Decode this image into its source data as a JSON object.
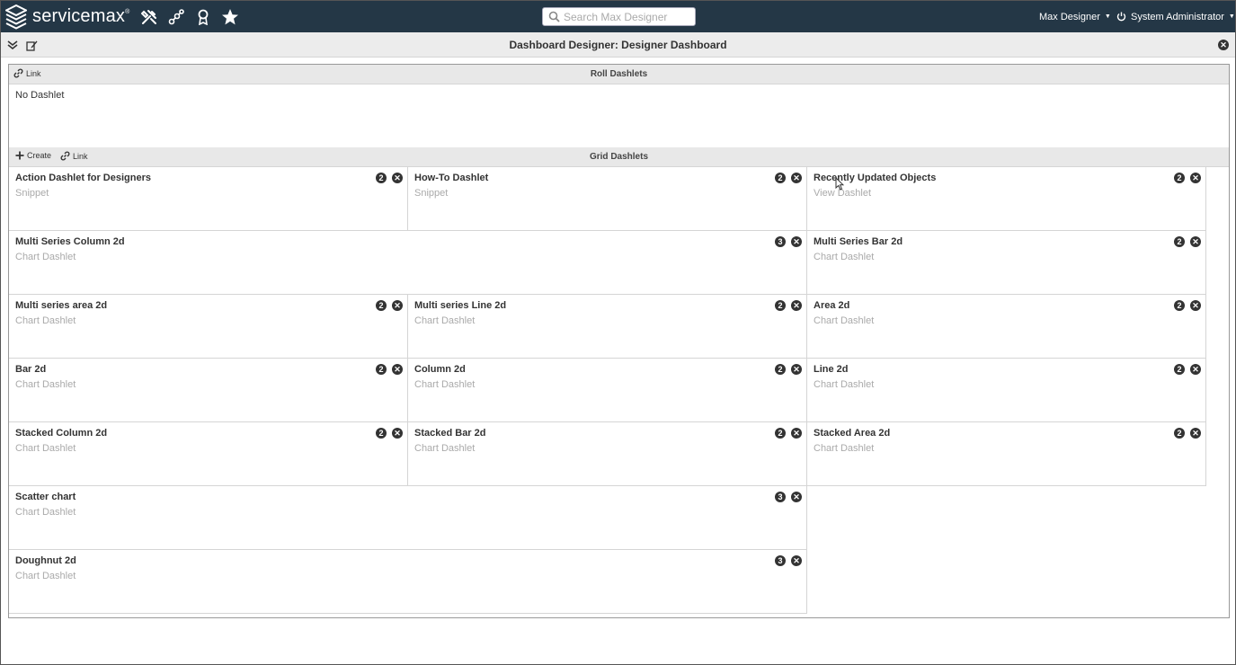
{
  "brand": {
    "name": "servicemax"
  },
  "nav_icons": [
    "tools-icon",
    "connections-icon",
    "badge-icon",
    "star-icon"
  ],
  "search": {
    "placeholder": "Search Max Designer"
  },
  "header_menus": {
    "app_label": "Max Designer",
    "user_label": "System Administrator"
  },
  "page": {
    "title": "Dashboard Designer: Designer Dashboard"
  },
  "roll_section": {
    "title": "Roll Dashlets",
    "link_label": "Link",
    "empty_text": "No Dashlet"
  },
  "grid_section": {
    "title": "Grid Dashlets",
    "create_label": "Create",
    "link_label": "Link"
  },
  "dashlets": [
    {
      "title": "Action Dashlet for Designers",
      "type": "Snippet",
      "size": "2"
    },
    {
      "title": "How-To Dashlet",
      "type": "Snippet",
      "size": "2"
    },
    {
      "title": "Recently Updated Objects",
      "type": "View Dashlet",
      "size": "2"
    },
    {
      "title": "Multi Series Column 2d",
      "type": "Chart Dashlet",
      "size": "3"
    },
    {
      "title": "Multi Series Bar 2d",
      "type": "Chart Dashlet",
      "size": "2"
    },
    {
      "title": "Multi series area 2d",
      "type": "Chart Dashlet",
      "size": "2"
    },
    {
      "title": "Multi series Line 2d",
      "type": "Chart Dashlet",
      "size": "2"
    },
    {
      "title": "Area 2d",
      "type": "Chart Dashlet",
      "size": "2"
    },
    {
      "title": "Bar 2d",
      "type": "Chart Dashlet",
      "size": "2"
    },
    {
      "title": "Column 2d",
      "type": "Chart Dashlet",
      "size": "2"
    },
    {
      "title": "Line 2d",
      "type": "Chart Dashlet",
      "size": "2"
    },
    {
      "title": "Stacked Column 2d",
      "type": "Chart Dashlet",
      "size": "2"
    },
    {
      "title": "Stacked Bar 2d",
      "type": "Chart Dashlet",
      "size": "2"
    },
    {
      "title": "Stacked Area 2d",
      "type": "Chart Dashlet",
      "size": "2"
    },
    {
      "title": "Scatter chart",
      "type": "Chart Dashlet",
      "size": "3"
    },
    {
      "title": "Doughnut 2d",
      "type": "Chart Dashlet",
      "size": "3"
    }
  ],
  "colors": {
    "topbar": "#243746",
    "subheader": "#ececec",
    "section_bar": "#e8e8e8",
    "muted_text": "#aaaaaa"
  }
}
